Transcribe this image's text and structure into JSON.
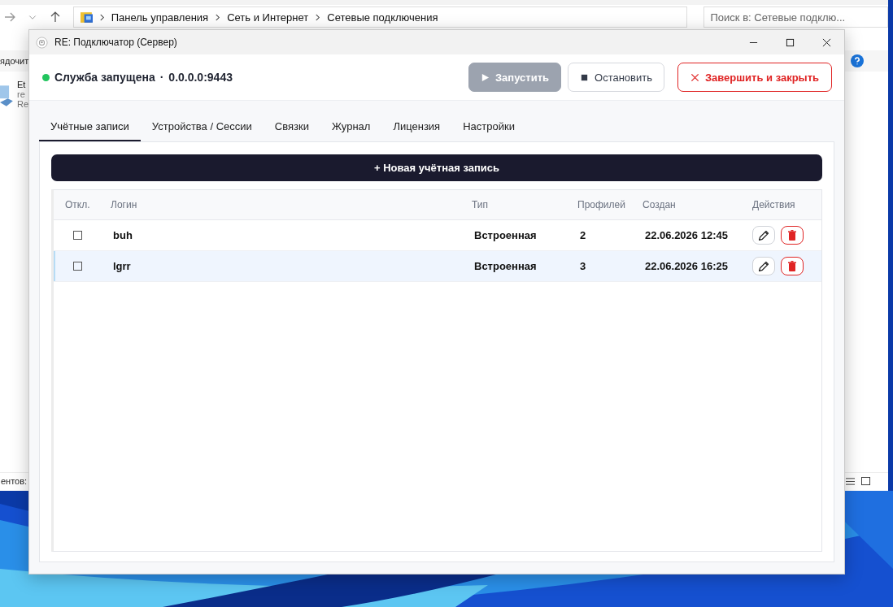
{
  "explorer": {
    "breadcrumbs": [
      "Панель управления",
      "Сеть и Интернет",
      "Сетевые подключения"
    ],
    "search": {
      "placeholder": "Поиск в: Сетевые подклю..."
    },
    "command_fragment": "ядочит",
    "item_fragments": [
      "Et",
      "re",
      "Re"
    ],
    "status_fragment": "ентов:"
  },
  "window": {
    "title": "RE: Подключатор (Сервер)"
  },
  "status": {
    "running": true,
    "text": "Служба запущена",
    "separator": "·",
    "address": "0.0.0.0:9443"
  },
  "buttons": [
    {
      "kind": "start",
      "label": "Запустить",
      "disabled": true
    },
    {
      "kind": "stop",
      "label": "Остановить",
      "disabled": false
    },
    {
      "kind": "quit",
      "label": "Завершить и закрыть",
      "disabled": false
    }
  ],
  "tabs": [
    {
      "label": "Учётные записи",
      "selected": true
    },
    {
      "label": "Устройства / Сессии",
      "selected": false
    },
    {
      "label": "Связки",
      "selected": false
    },
    {
      "label": "Журнал",
      "selected": false
    },
    {
      "label": "Лицензия",
      "selected": false
    },
    {
      "label": "Настройки",
      "selected": false
    }
  ],
  "new_button": "+ Новая учётная запись",
  "table": {
    "columns": [
      "Откл.",
      "Логин",
      "Тип",
      "Профилей",
      "Создан",
      "Действия"
    ],
    "rows": [
      {
        "disabled": false,
        "login": "buh",
        "type": "Встроенная",
        "profiles": "2",
        "created": "22.06.2026 12:45",
        "selected": false
      },
      {
        "disabled": false,
        "login": "lgrr",
        "type": "Встроенная",
        "profiles": "3",
        "created": "22.06.2026 16:25",
        "selected": true
      }
    ]
  }
}
